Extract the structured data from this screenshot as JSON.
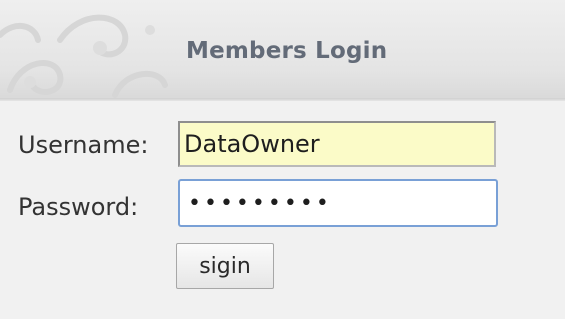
{
  "login_panel": {
    "title": "Members Login",
    "username": {
      "label": "Username:",
      "value": "DataOwner"
    },
    "password": {
      "label": "Password:",
      "masked_value": "•••••••••"
    },
    "submit_label": "sigin"
  },
  "colors": {
    "header_title": "#636b78",
    "username_field_bg": "#fbfbc8",
    "password_field_border": "#79a0d6",
    "panel_bg": "#f1f1f1"
  },
  "icons": {
    "header_ornament": "decorative-swirl"
  }
}
